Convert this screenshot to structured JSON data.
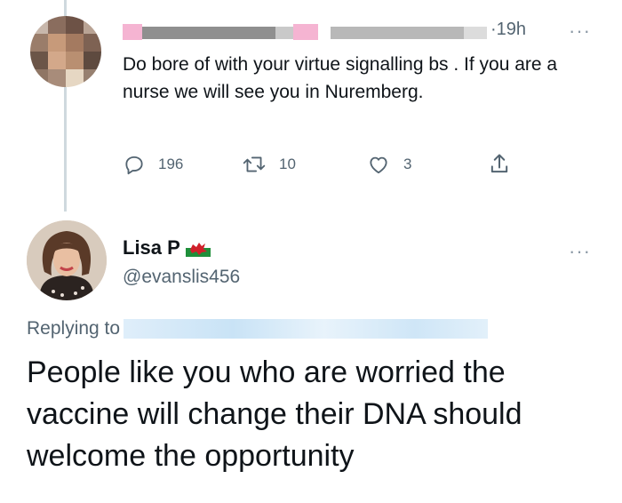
{
  "original_tweet": {
    "timestamp": "19h",
    "more_label": "···",
    "text": "Do bore of with your virtue signalling bs . If you are a nurse we will see you in Nuremberg.",
    "counts": {
      "replies": "196",
      "retweets": "10",
      "likes": "3"
    }
  },
  "reply_tweet": {
    "display_name": "Lisa P",
    "flag": "wales-flag",
    "handle": "@evanslis456",
    "more_label": "···",
    "replying_label": "Replying to",
    "text": "People like you who are worried the vaccine will change their DNA should welcome the opportunity"
  },
  "colors": {
    "secondary_text": "#536471",
    "primary_text": "#0f1419",
    "thread_line": "#cfd9de"
  }
}
